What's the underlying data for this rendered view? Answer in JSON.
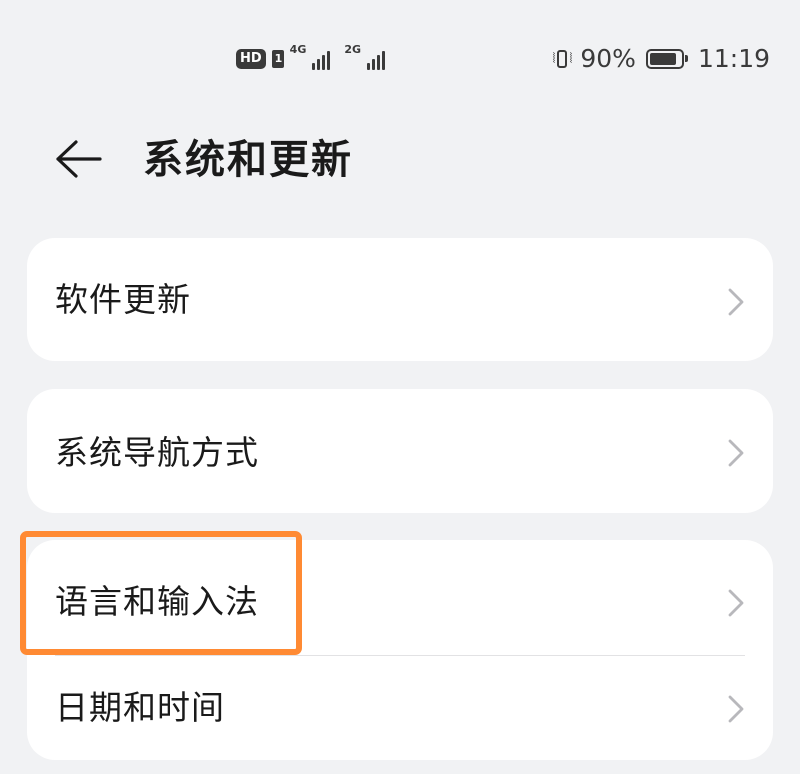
{
  "status_bar": {
    "hd_label": "HD",
    "sim1_network": "4G",
    "sim2_network": "2G",
    "battery_percent": "90%",
    "battery_level": 0.9,
    "time": "11:19"
  },
  "header": {
    "back_icon": "arrow-left-icon",
    "title": "系统和更新"
  },
  "settings": {
    "groups": [
      {
        "items": [
          {
            "label": "软件更新",
            "icon": "chevron-right-icon"
          }
        ]
      },
      {
        "items": [
          {
            "label": "系统导航方式",
            "icon": "chevron-right-icon"
          }
        ]
      },
      {
        "items": [
          {
            "label": "语言和输入法",
            "icon": "chevron-right-icon"
          },
          {
            "label": "日期和时间",
            "icon": "chevron-right-icon"
          }
        ]
      }
    ]
  },
  "annotation": {
    "highlight_color": "#ff8a33"
  },
  "colors": {
    "background": "#f1f2f4",
    "card": "#ffffff",
    "text": "#1a1a1a",
    "chevron": "#b8b8bc"
  }
}
